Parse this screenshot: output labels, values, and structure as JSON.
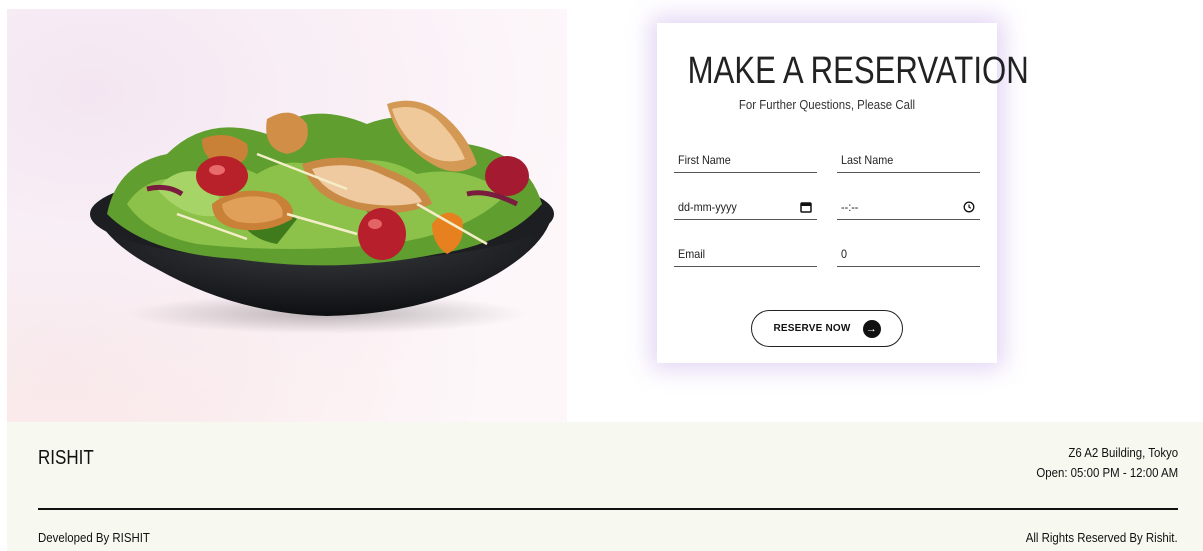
{
  "reservation": {
    "title": "MAKE A RESERVATION",
    "subtitle": "For Further Questions, Please Call",
    "first_name_placeholder": "First Name",
    "last_name_placeholder": "Last Name",
    "date_value": "dd-mm-yyyy",
    "time_value": "--:--",
    "email_placeholder": "Email",
    "guests_value": "0",
    "reserve_label": "RESERVE NOW"
  },
  "footer": {
    "brand": "RISHIT",
    "address": "Z6 A2 Building, Tokyo",
    "hours": "Open: 05:00 PM - 12:00 AM",
    "developed_by": "Developed By RISHIT",
    "rights": "All Rights Reserved By Rishit."
  },
  "icons": {
    "calendar": "calendar-icon",
    "clock": "clock-icon",
    "arrow": "arrow-right-icon"
  },
  "colors": {
    "card_glow": "#bea0e6",
    "footer_bg": "#f7f8f0",
    "button_accent": "#111111"
  }
}
